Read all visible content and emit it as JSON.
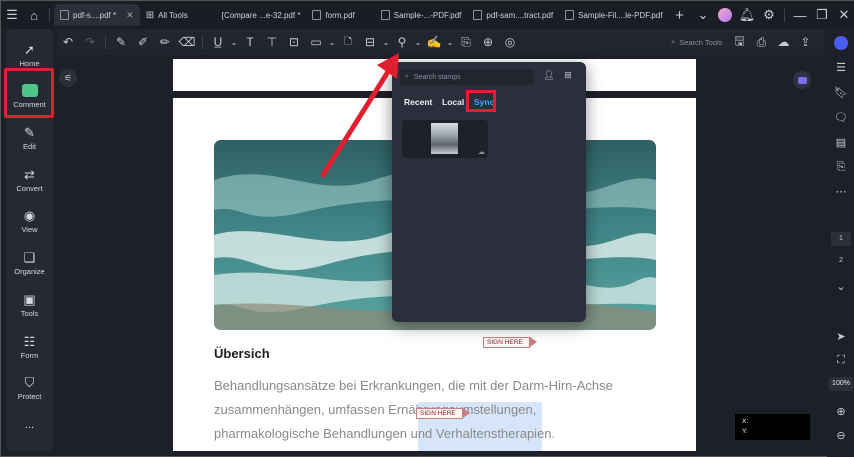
{
  "tabs": [
    {
      "label": "pdf-s....pdf *",
      "active": true
    },
    {
      "label": "All Tools",
      "active": false
    },
    {
      "label": "[Compare ...e-32.pdf *",
      "active": false
    },
    {
      "label": "form.pdf",
      "active": false
    },
    {
      "label": "Sample-...-PDF.pdf",
      "active": false
    },
    {
      "label": "pdf-sam....tract.pdf",
      "active": false
    },
    {
      "label": "Sample-Fil....le-PDF.pdf",
      "active": false
    }
  ],
  "sidebar": {
    "items": [
      {
        "label": "Home",
        "icon": "rocket-icon"
      },
      {
        "label": "Comment",
        "icon": "comment-icon"
      },
      {
        "label": "Edit",
        "icon": "edit-icon"
      },
      {
        "label": "Convert",
        "icon": "convert-icon"
      },
      {
        "label": "View",
        "icon": "eye-icon"
      },
      {
        "label": "Organize",
        "icon": "organize-icon"
      },
      {
        "label": "Tools",
        "icon": "toolbox-icon"
      },
      {
        "label": "Form",
        "icon": "form-icon"
      },
      {
        "label": "Protect",
        "icon": "shield-icon"
      }
    ],
    "more": "..."
  },
  "toolbar": {
    "search_placeholder": "Search Tools"
  },
  "stamp_popup": {
    "search_placeholder": "Search stamps",
    "tabs": [
      "Recent",
      "Local",
      "Sync"
    ],
    "active_tab": "Sync"
  },
  "document": {
    "heading": "Übersich",
    "paragraph_lines": [
      "Behandlungsansätze bei Erkrankungen, die mit der Darm-Hirn-Achse",
      "zusammenhängen, umfassen Ernährungsumstellungen,",
      "pharmakologische Behandlungen und Verhaltenstherapien."
    ],
    "sign_label": "SIGN HERE"
  },
  "right_rail": {
    "pages": [
      "1",
      "2"
    ],
    "zoom": "100%"
  },
  "coords": {
    "x_label": "X:",
    "y_label": "Y:"
  },
  "colors": {
    "highlight_red": "#e02030",
    "accent_blue": "#4aa0ff",
    "comment_green": "#4ec48b"
  }
}
